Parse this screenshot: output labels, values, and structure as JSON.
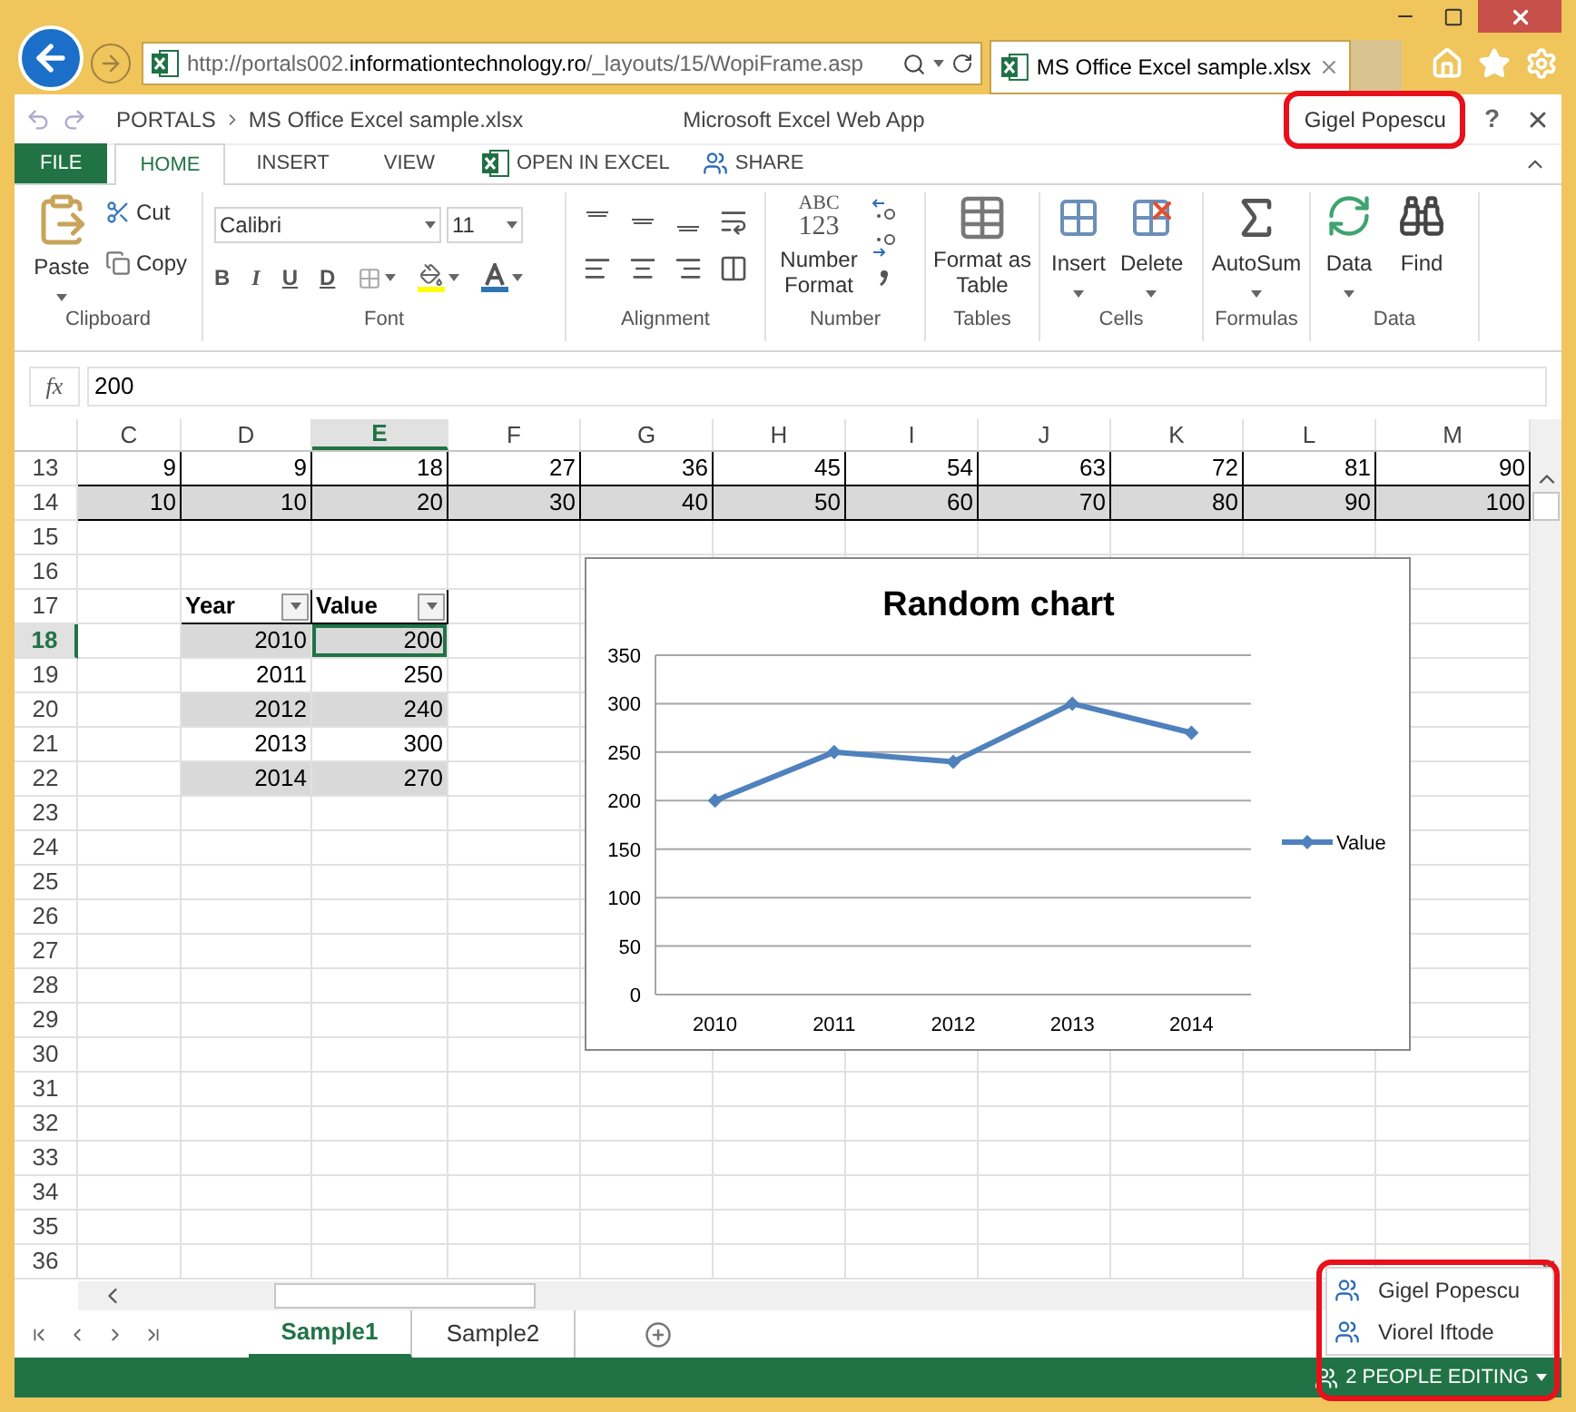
{
  "browser": {
    "address": {
      "scheme": "http://portals002.",
      "domain": "informationtechnology.ro",
      "path": "/_layouts/15/WopiFrame.asp"
    },
    "tab": {
      "title": "MS Office Excel sample.xlsx"
    }
  },
  "app_bar": {
    "breadcrumb": [
      "PORTALS",
      "MS Office Excel sample.xlsx"
    ],
    "title": "Microsoft Excel Web App",
    "user": {
      "name": "Gigel Popescu",
      "highlighted": true
    },
    "help": "?"
  },
  "tabs": [
    {
      "label": "FILE",
      "kind": "file",
      "selected": false
    },
    {
      "label": "HOME",
      "kind": "tab",
      "selected": true
    },
    {
      "label": "INSERT",
      "kind": "tab",
      "selected": false
    },
    {
      "label": "VIEW",
      "kind": "tab",
      "selected": false
    },
    {
      "label": "OPEN IN EXCEL",
      "kind": "command",
      "selected": false
    },
    {
      "label": "SHARE",
      "kind": "command",
      "selected": false
    }
  ],
  "ribbon": {
    "clipboard": {
      "label": "Clipboard",
      "paste": "Paste",
      "cut": "Cut",
      "copy": "Copy"
    },
    "font": {
      "label": "Font",
      "name": "Calibri",
      "size": "11",
      "styles": [
        "B",
        "I",
        "U",
        "D"
      ]
    },
    "alignment": {
      "label": "Alignment"
    },
    "number": {
      "label": "Number",
      "icon_text": [
        "ABC",
        "123"
      ],
      "command": "Number Format"
    },
    "tables": {
      "label": "Tables",
      "command": "Format as Table"
    },
    "cells": {
      "label": "Cells",
      "commands": [
        "Insert",
        "Delete"
      ]
    },
    "formulas": {
      "label": "Formulas",
      "commands": [
        "AutoSum"
      ]
    },
    "data": {
      "label": "Data",
      "commands": [
        "Data",
        "Find"
      ]
    }
  },
  "formula_bar": {
    "fx": "fx",
    "value": "200"
  },
  "sheet": {
    "columns": [
      {
        "label": "C",
        "selected": false
      },
      {
        "label": "D",
        "selected": false
      },
      {
        "label": "E",
        "selected": true
      },
      {
        "label": "F",
        "selected": false
      },
      {
        "label": "G",
        "selected": false
      },
      {
        "label": "H",
        "selected": false
      },
      {
        "label": "I",
        "selected": false
      },
      {
        "label": "J",
        "selected": false
      },
      {
        "label": "K",
        "selected": false
      },
      {
        "label": "L",
        "selected": false
      },
      {
        "label": "M",
        "selected": false
      }
    ],
    "rows": [
      {
        "number": "13",
        "selected": false,
        "boxed": true,
        "cells": [
          {
            "text": "9"
          },
          {
            "text": "9"
          },
          {
            "text": "18"
          },
          {
            "text": "27"
          },
          {
            "text": "36"
          },
          {
            "text": "45"
          },
          {
            "text": "54"
          },
          {
            "text": "63"
          },
          {
            "text": "72"
          },
          {
            "text": "81"
          },
          {
            "text": "90"
          }
        ]
      },
      {
        "number": "14",
        "selected": false,
        "boxed": true,
        "cells": [
          {
            "text": "10",
            "shaded": true
          },
          {
            "text": "10",
            "shaded": true
          },
          {
            "text": "20",
            "shaded": true
          },
          {
            "text": "30",
            "shaded": true
          },
          {
            "text": "40",
            "shaded": true
          },
          {
            "text": "50",
            "shaded": true
          },
          {
            "text": "60",
            "shaded": true
          },
          {
            "text": "70",
            "shaded": true
          },
          {
            "text": "80",
            "shaded": true
          },
          {
            "text": "90",
            "shaded": true
          },
          {
            "text": "100",
            "shaded": true
          }
        ]
      },
      {
        "number": "15",
        "selected": false
      },
      {
        "number": "16",
        "selected": false
      },
      {
        "number": "17",
        "selected": false,
        "cells": [
          {},
          {
            "text": "Year",
            "kind": "header"
          },
          {
            "text": "Value",
            "kind": "header"
          }
        ]
      },
      {
        "number": "18",
        "selected": true,
        "cells": [
          {},
          {
            "text": "2010",
            "shaded": true
          },
          {
            "text": "200",
            "shaded": true
          }
        ]
      },
      {
        "number": "19",
        "selected": false,
        "cells": [
          {},
          {
            "text": "2011"
          },
          {
            "text": "250"
          }
        ]
      },
      {
        "number": "20",
        "selected": false,
        "cells": [
          {},
          {
            "text": "2012",
            "shaded": true
          },
          {
            "text": "240",
            "shaded": true
          }
        ]
      },
      {
        "number": "21",
        "selected": false,
        "cells": [
          {},
          {
            "text": "2013"
          },
          {
            "text": "300"
          }
        ]
      },
      {
        "number": "22",
        "selected": false,
        "cells": [
          {},
          {
            "text": "2014",
            "shaded": true
          },
          {
            "text": "270",
            "shaded": true
          }
        ]
      },
      {
        "number": "23",
        "selected": false
      },
      {
        "number": "24",
        "selected": false
      },
      {
        "number": "25",
        "selected": false
      },
      {
        "number": "26",
        "selected": false
      },
      {
        "number": "27",
        "selected": false
      },
      {
        "number": "28",
        "selected": false
      },
      {
        "number": "29",
        "selected": false
      },
      {
        "number": "30",
        "selected": false
      },
      {
        "number": "31",
        "selected": false
      },
      {
        "number": "32",
        "selected": false
      },
      {
        "number": "33",
        "selected": false
      },
      {
        "number": "34",
        "selected": false
      },
      {
        "number": "35",
        "selected": false
      },
      {
        "number": "36",
        "selected": false
      }
    ],
    "chart_data": {
      "type": "line",
      "title": "Random chart",
      "categories": [
        "2010",
        "2011",
        "2012",
        "2013",
        "2014"
      ],
      "series": [
        {
          "name": "Value",
          "color": "#4f81bd",
          "values": [
            200,
            250,
            240,
            300,
            270
          ]
        }
      ],
      "ylim": [
        0,
        350
      ],
      "yticks": [
        0,
        50,
        100,
        150,
        200,
        250,
        300,
        350
      ],
      "grid": true,
      "marker": "diamond"
    }
  },
  "sheet_tabs": [
    {
      "label": "Sample1",
      "selected": true
    },
    {
      "label": "Sample2",
      "selected": false
    }
  ],
  "status_bar": {
    "editing": "2 PEOPLE EDITING",
    "popup_open": true,
    "highlighted": true,
    "people": [
      "Gigel Popescu",
      "Viorel Iftode"
    ]
  }
}
